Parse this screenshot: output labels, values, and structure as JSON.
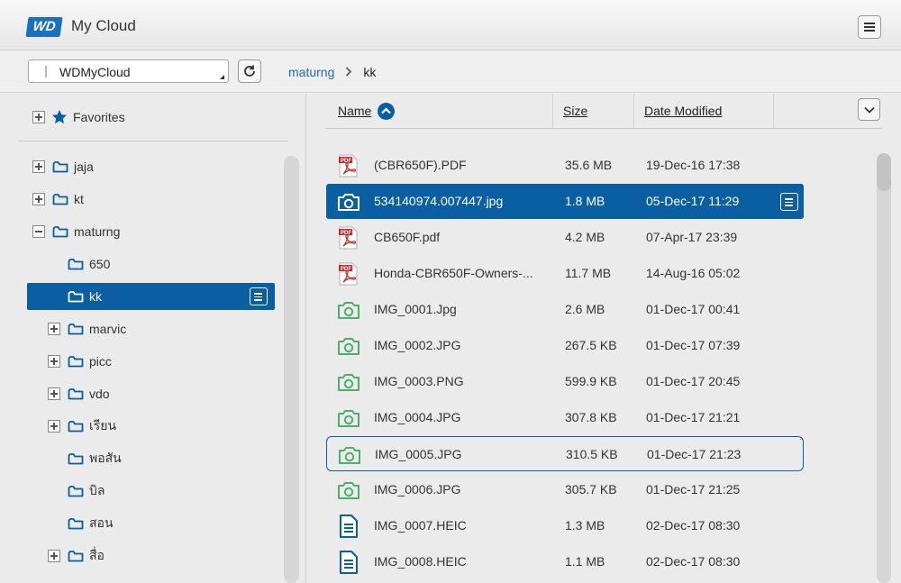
{
  "app": {
    "logo_text": "WD",
    "title": "My Cloud"
  },
  "toolbar": {
    "device": "WDMyCloud",
    "breadcrumb": [
      {
        "label": "maturng"
      },
      {
        "label": "kk"
      }
    ]
  },
  "tree": {
    "favorites": "Favorites",
    "items": [
      {
        "label": "jaja",
        "level": 1,
        "expander": "plus"
      },
      {
        "label": "kt",
        "level": 1,
        "expander": "plus"
      },
      {
        "label": "maturng",
        "level": 1,
        "expander": "minus"
      },
      {
        "label": "650",
        "level": 2,
        "expander": "none"
      },
      {
        "label": "kk",
        "level": 2,
        "expander": "none",
        "selected": true
      },
      {
        "label": "marvic",
        "level": 2,
        "expander": "plus"
      },
      {
        "label": "picc",
        "level": 2,
        "expander": "plus"
      },
      {
        "label": "vdo",
        "level": 2,
        "expander": "plus"
      },
      {
        "label": "เรียน",
        "level": 2,
        "expander": "plus"
      },
      {
        "label": "พอสัน",
        "level": 2,
        "expander": "none"
      },
      {
        "label": "บิล",
        "level": 2,
        "expander": "none"
      },
      {
        "label": "สอน",
        "level": 2,
        "expander": "none"
      },
      {
        "label": "สื่อ",
        "level": 2,
        "expander": "plus"
      }
    ]
  },
  "columns": {
    "name": "Name",
    "size": "Size",
    "date": "Date Modified"
  },
  "files": [
    {
      "name": "(CBR650F).PDF",
      "size": "35.6 MB",
      "date": "19-Dec-16 17:38",
      "type": "pdf"
    },
    {
      "name": "534140974.007447.jpg",
      "size": "1.8 MB",
      "date": "05-Dec-17 11:29",
      "type": "photo",
      "selected": true
    },
    {
      "name": "CB650F.pdf",
      "size": "4.2 MB",
      "date": "07-Apr-17 23:39",
      "type": "pdf"
    },
    {
      "name": "Honda-CBR650F-Owners-...",
      "size": "11.7 MB",
      "date": "14-Aug-16 05:02",
      "type": "pdf"
    },
    {
      "name": "IMG_0001.Jpg",
      "size": "2.6 MB",
      "date": "01-Dec-17 00:41",
      "type": "photo"
    },
    {
      "name": "IMG_0002.JPG",
      "size": "267.5 KB",
      "date": "01-Dec-17 07:39",
      "type": "photo"
    },
    {
      "name": "IMG_0003.PNG",
      "size": "599.9 KB",
      "date": "01-Dec-17 20:45",
      "type": "photo"
    },
    {
      "name": "IMG_0004.JPG",
      "size": "307.8 KB",
      "date": "01-Dec-17 21:21",
      "type": "photo"
    },
    {
      "name": "IMG_0005.JPG",
      "size": "310.5 KB",
      "date": "01-Dec-17 21:23",
      "type": "photo",
      "focused": true
    },
    {
      "name": "IMG_0006.JPG",
      "size": "305.7 KB",
      "date": "01-Dec-17 21:25",
      "type": "photo"
    },
    {
      "name": "IMG_0007.HEIC",
      "size": "1.3 MB",
      "date": "02-Dec-17 08:30",
      "type": "doc"
    },
    {
      "name": "IMG_0008.HEIC",
      "size": "1.1 MB",
      "date": "02-Dec-17 08:30",
      "type": "doc"
    }
  ],
  "colors": {
    "accent": "#0a5fa3",
    "link": "#1e6cb0",
    "photo_icon": "#4caf6a",
    "pdf_icon": "#c62828"
  }
}
